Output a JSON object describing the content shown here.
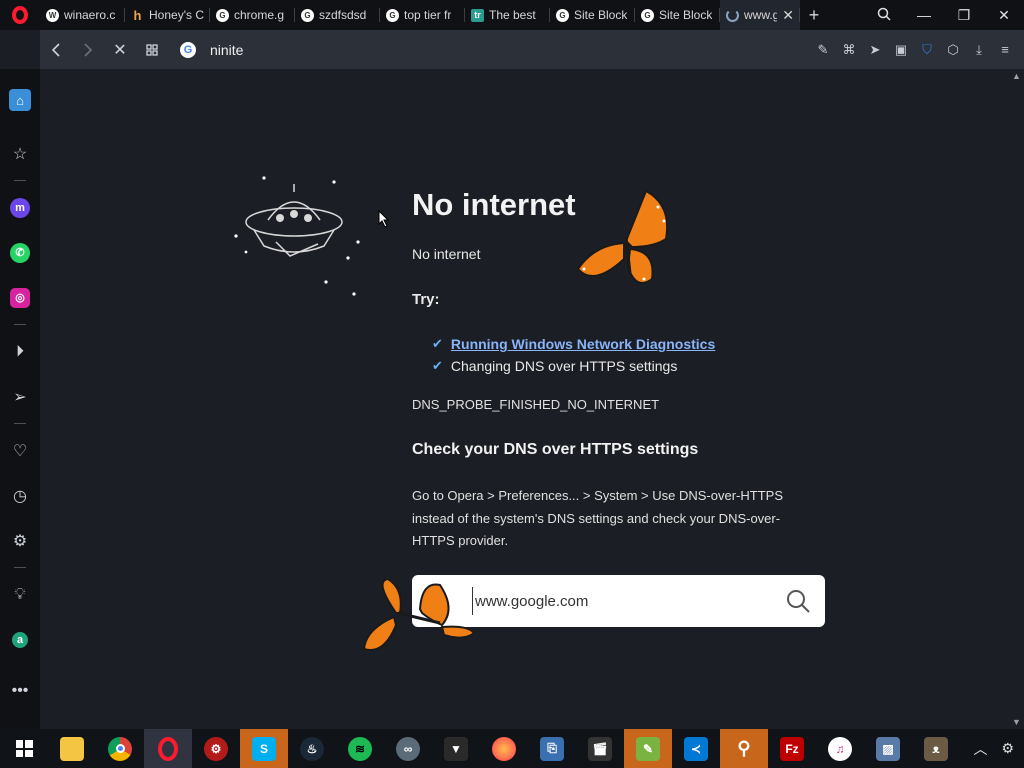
{
  "browser": {
    "tabs": [
      {
        "title": "winaero.c",
        "favicon": "wordpress-icon"
      },
      {
        "title": "Honey's C",
        "favicon": "honey-icon"
      },
      {
        "title": "chrome.g",
        "favicon": "google-icon"
      },
      {
        "title": "szdfsdsd",
        "favicon": "google-icon"
      },
      {
        "title": "top tier fr",
        "favicon": "google-icon"
      },
      {
        "title": "The best",
        "favicon": "tr-icon"
      },
      {
        "title": "Site Block",
        "favicon": "site-block-icon"
      },
      {
        "title": "Site Block",
        "favicon": "site-block-icon"
      },
      {
        "title": "www.g",
        "favicon": "loading-spinner-icon",
        "active": true
      }
    ],
    "new_tab_label": "+",
    "address": "ninite"
  },
  "page": {
    "title": "No internet",
    "subtitle": "No internet",
    "try_label": "Try:",
    "suggestions": [
      "Running Windows Network Diagnostics",
      "Changing DNS over HTTPS settings"
    ],
    "error_code": "DNS_PROBE_FINISHED_NO_INTERNET",
    "dns_heading": "Check your DNS over HTTPS settings",
    "dns_text": "Go to Opera > Preferences... > System > Use DNS-over-HTTPS instead of the system's DNS settings and check your DNS-over-HTTPS provider.",
    "search_value": "www.google.com"
  },
  "colors": {
    "accent": "#3a8fd8",
    "link": "#8ab4f8",
    "page_bg": "#1b1e25",
    "opera_red": "#ff1b2d",
    "butterfly_orange": "#f07f16"
  }
}
